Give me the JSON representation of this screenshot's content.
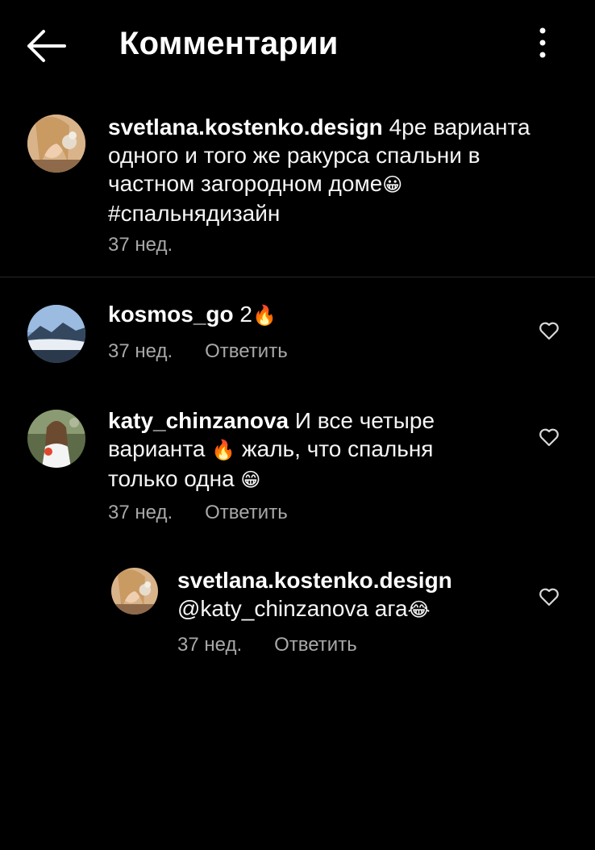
{
  "header": {
    "title": "Комментарии",
    "back_icon": "arrow-left-icon",
    "more_icon": "more-vertical-icon"
  },
  "caption": {
    "username": "svetlana.kostenko.design",
    "text_line1": " 4ре варианта",
    "text_line2": "одного и того же ракурса спальни в",
    "text_line3": "частном загородном доме",
    "emoji1": "😀",
    "hashtag": "#спальнядизайн",
    "time": "37 нед."
  },
  "comments": [
    {
      "username": "kosmos_go",
      "text": " 2",
      "emoji": "🔥",
      "time": "37 нед.",
      "reply_label": "Ответить"
    },
    {
      "username": "katy_chinzanova",
      "text_line1": " И все четыре",
      "text_line2a": "варианта ",
      "emoji_a": "🔥",
      "text_line2b": " жаль, что спальня",
      "text_line3": "только одна ",
      "emoji_b": "😁",
      "time": "37 нед.",
      "reply_label": "Ответить"
    }
  ],
  "reply": {
    "username": "svetlana.kostenko.design",
    "mention": "@katy_chinzanova",
    "text": " ага",
    "emoji": "😂",
    "time": "37 нед.",
    "reply_label": "Ответить"
  },
  "colors": {
    "background": "#000000",
    "text": "#ffffff",
    "secondary_text": "#a8a8a8",
    "divider": "#262626"
  }
}
